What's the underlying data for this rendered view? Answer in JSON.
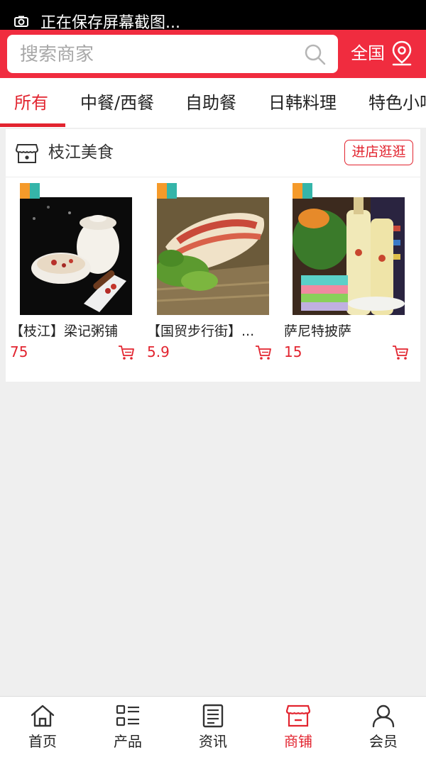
{
  "status_bar": {
    "text": "正在保存屏幕截图..."
  },
  "header": {
    "search_placeholder": "搜索商家",
    "region_label": "全国",
    "brand_color": "#f02c3f"
  },
  "tabs": [
    {
      "label": "所有",
      "active": true
    },
    {
      "label": "中餐/西餐",
      "active": false
    },
    {
      "label": "自助餐",
      "active": false
    },
    {
      "label": "日韩料理",
      "active": false
    },
    {
      "label": "特色小吃",
      "active": false
    }
  ],
  "shop": {
    "name": "枝江美食",
    "visit_label": "进店逛逛",
    "products": [
      {
        "title": "【枝江】梁记粥铺",
        "price": "75"
      },
      {
        "title": "【国贸步行街】...",
        "price": "5.9"
      },
      {
        "title": "萨尼特披萨",
        "price": "15"
      }
    ]
  },
  "bottom_nav": [
    {
      "label": "首页",
      "icon": "home-icon",
      "active": false
    },
    {
      "label": "产品",
      "icon": "grid-list-icon",
      "active": false
    },
    {
      "label": "资讯",
      "icon": "news-icon",
      "active": false
    },
    {
      "label": "商铺",
      "icon": "store-icon",
      "active": true
    },
    {
      "label": "会员",
      "icon": "user-icon",
      "active": false
    }
  ],
  "colors": {
    "accent": "#e2242f",
    "background": "#efefef"
  }
}
